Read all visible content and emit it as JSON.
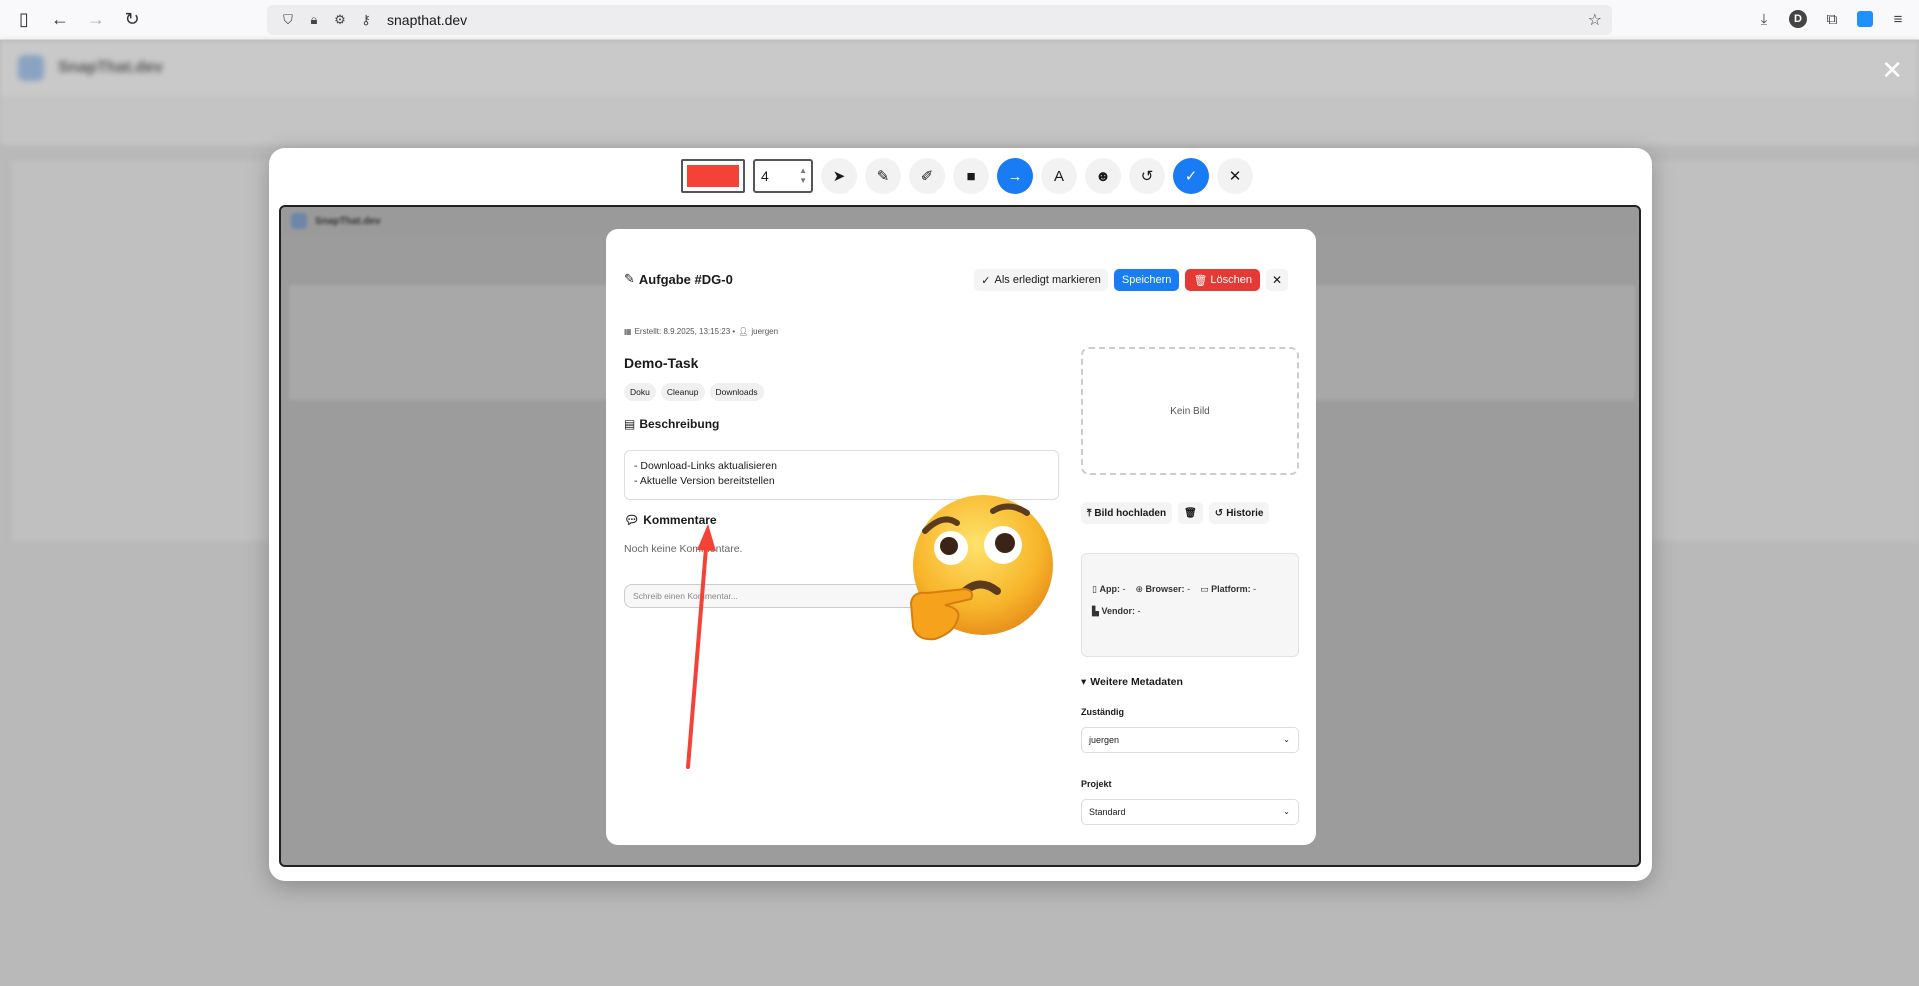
{
  "browser": {
    "url": "snapthat.dev",
    "profile_initial": "D"
  },
  "background": {
    "app_title": "SnapThat.dev"
  },
  "toolbar": {
    "color": "#f44336",
    "stroke_size": "4",
    "tools": [
      {
        "name": "pointer-icon",
        "glyph": "➤",
        "active": false
      },
      {
        "name": "pencil-icon",
        "glyph": "✎",
        "active": false
      },
      {
        "name": "marker-icon",
        "glyph": "✐",
        "active": false
      },
      {
        "name": "rectangle-icon",
        "glyph": "■",
        "active": false
      },
      {
        "name": "arrow-icon",
        "glyph": "→",
        "active": true
      },
      {
        "name": "text-icon",
        "glyph": "A",
        "active": false
      },
      {
        "name": "emoji-icon",
        "glyph": "☻",
        "active": false
      },
      {
        "name": "undo-icon",
        "glyph": "↺",
        "active": false
      },
      {
        "name": "confirm-icon",
        "glyph": "✓",
        "active": true
      },
      {
        "name": "cancel-icon",
        "glyph": "✕",
        "active": false
      }
    ]
  },
  "task": {
    "title": "Aufgabe #DG-0",
    "mark_done_label": "Als erledigt markieren",
    "save_label": "Speichern",
    "delete_label": "Löschen",
    "created": "Erstellt: 8.9.2025, 13:15:23 •",
    "author": "juergen",
    "name": "Demo-Task",
    "tags": [
      "Doku",
      "Cleanup",
      "Downloads"
    ],
    "description_heading": "Beschreibung",
    "description_lines": [
      "- Download-Links aktualisieren",
      "- Aktuelle Version bereitstellen"
    ],
    "comments_heading": "Kommentare",
    "no_comments": "Noch keine Kommentare.",
    "comment_placeholder": "Schreib einen Kommentar...",
    "no_image": "Kein Bild",
    "upload_label": "Bild hochladen",
    "history_label": "Historie",
    "device": {
      "app_label": "App:",
      "app_value": "-",
      "browser_label": "Browser:",
      "browser_value": "-",
      "platform_label": "Platform:",
      "platform_value": "-",
      "vendor_label": "Vendor:",
      "vendor_value": "-"
    },
    "more_meta_label": "Weitere Metadaten",
    "assignee_label": "Zuständig",
    "assignee_value": "juergen",
    "project_label": "Projekt",
    "project_value": "Standard"
  },
  "colors": {
    "accent": "#1a7cf5",
    "danger": "#e53935",
    "annotation": "#f44336"
  }
}
